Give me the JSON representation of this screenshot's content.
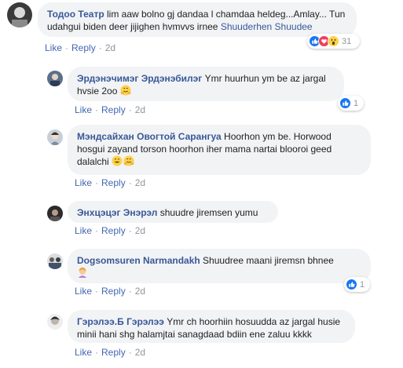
{
  "comments": [
    {
      "author": "Тодоо Театр",
      "text": "lim aaw bolno gj dandaa l chamdaa heldeg...Amlay... Tun udahgui biden deer jijighen hvmvvs irnee",
      "tag": "Shuuderhen Shuudee",
      "like": "Like",
      "reply": "Reply",
      "time": "2d",
      "reactions": [
        "like-icon",
        "love-icon",
        "wow-icon"
      ],
      "reaction_count": "31"
    },
    {
      "author": "Эрдэнэчимэг Эрдэнэбилэг",
      "text": "Ymr huurhun ym be az jargal hvsie 2oo",
      "emojis": [
        "hug-emoji"
      ],
      "like": "Like",
      "reply": "Reply",
      "time": "2d",
      "reactions": [
        "like-icon"
      ],
      "reaction_count": "1"
    },
    {
      "author": "Мэндсайхан Овогтой Сарангуа",
      "text": "Hoorhon ym be. Horwood hosgui zayand torson hoorhon iher mama nartai blooroi geed dalalchi",
      "emojis": [
        "smile-emoji",
        "hug-emoji"
      ],
      "like": "Like",
      "reply": "Reply",
      "time": "2d"
    },
    {
      "author": "Энхцэцэг Энэрэл",
      "text": "shuudre jiremsen yumu",
      "like": "Like",
      "reply": "Reply",
      "time": "2d"
    },
    {
      "author": "Dogsomsuren Narmandakh",
      "text": "Shuudree maani jiremsn bhnee",
      "emojis": [
        "woman-gesture-emoji"
      ],
      "like": "Like",
      "reply": "Reply",
      "time": "2d",
      "reactions": [
        "like-icon"
      ],
      "reaction_count": "1"
    },
    {
      "author": "Гэрэлээ.Б Гэрэлээ",
      "text": "Ymr ch hoorhiin hosuudda az jargal husie minii hani shg halamjtai sanagdaad bdiin ene zaluu kkkk",
      "like": "Like",
      "reply": "Reply",
      "time": "2d"
    }
  ],
  "colors": {
    "link": "#385898",
    "action": "#4267b2",
    "muted": "#90949c",
    "bubble": "#f2f3f5",
    "like_blue": "#1877f2",
    "love_red": "#f33e58",
    "wow_yellow": "#fcd24b"
  }
}
